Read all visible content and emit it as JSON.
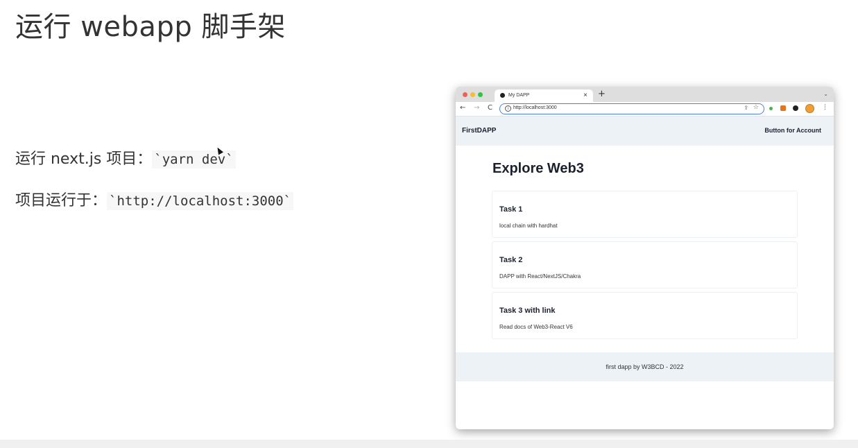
{
  "slide": {
    "title": "运行 webapp 脚手架",
    "line1_text": "运行 next.js 项目：",
    "line1_code": "`yarn dev`",
    "line2_text": "项目运行于：",
    "line2_code": "`http://localhost:3000`"
  },
  "browser": {
    "tab_title": "My DAPP",
    "tab_close": "×",
    "new_tab": "+",
    "tab_menu": "⌄",
    "url": "http://localhost:3000",
    "nav_back": "←",
    "nav_forward": "→",
    "nav_reload": "C",
    "url_info_icon": "i",
    "share_icon": "⇪",
    "star_icon": "☆",
    "menu_icon": "⋮"
  },
  "app": {
    "brand": "FirstDAPP",
    "account_button": "Button for Account",
    "heading": "Explore Web3",
    "cards": [
      {
        "title": "Task 1",
        "desc": "local chain with hardhat"
      },
      {
        "title": "Task 2",
        "desc": "DAPP with React/NextJS/Chakra"
      },
      {
        "title": "Task 3 with link",
        "desc": "Read docs of Web3-React V6"
      }
    ],
    "footer": "first dapp by W3BCD - 2022"
  },
  "colors": {
    "nav_bg": "#edf2f7",
    "url_border": "#4a7fdc",
    "traffic_red": "#f25f57",
    "traffic_yellow": "#f8bc30",
    "traffic_green": "#2ac841"
  }
}
